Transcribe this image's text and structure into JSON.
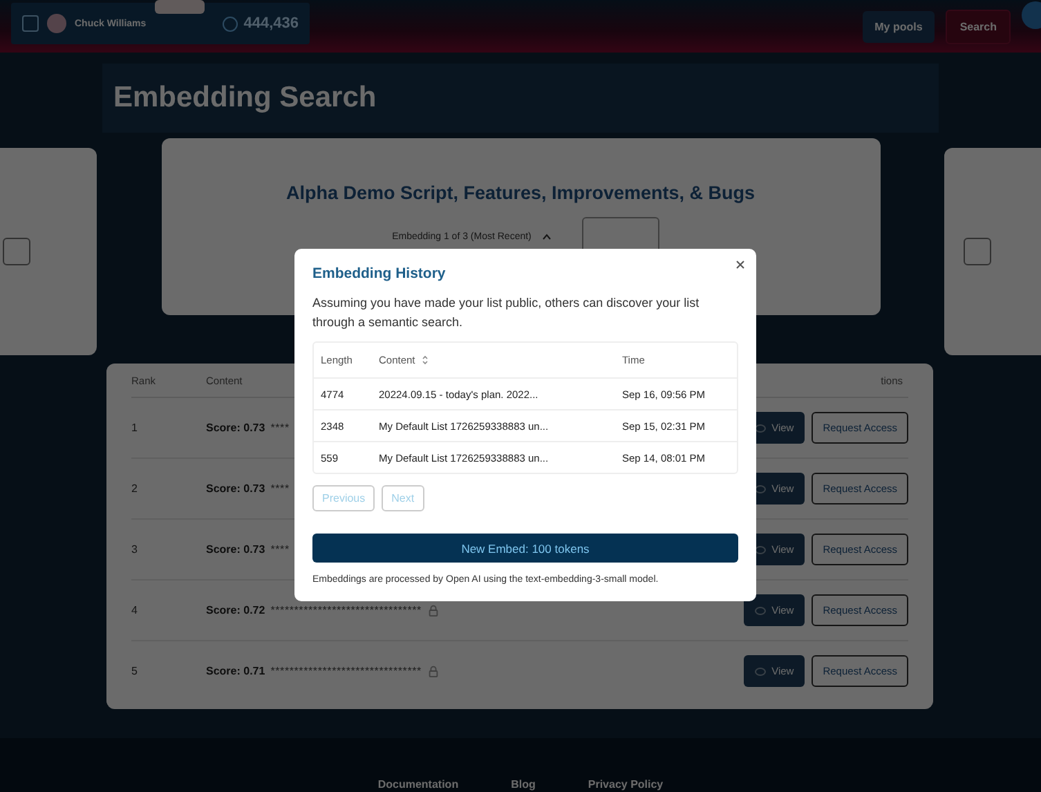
{
  "header": {
    "user_name": "Chuck Williams",
    "points": "444,436",
    "nav": [
      {
        "label": "My pools",
        "selected": false
      },
      {
        "label": "Search",
        "selected": true
      }
    ]
  },
  "page_title": "Embedding Search",
  "side_cards": [
    {
      "checked": false
    },
    {
      "checked": false
    }
  ],
  "list_card": {
    "title": "Alpha Demo Script, Features, Improvements, & Bugs",
    "select_value": "Embedding 1 of 3 (Most Recent)"
  },
  "results": {
    "columns": [
      "Rank",
      "Content",
      "tions"
    ],
    "rows": [
      {
        "rank": "1",
        "score": "Score: 0.73",
        "content": "****",
        "locked": false,
        "actions": [
          "View",
          "Request Access"
        ]
      },
      {
        "rank": "2",
        "score": "Score: 0.73",
        "content": "****",
        "locked": false,
        "actions": [
          "View",
          "Request Access"
        ]
      },
      {
        "rank": "3",
        "score": "Score: 0.73",
        "content": "****",
        "locked": false,
        "actions": [
          "View",
          "Request Access"
        ]
      },
      {
        "rank": "4",
        "score": "Score: 0.72",
        "content": "********************************",
        "locked": true,
        "actions": [
          "View",
          "Request Access"
        ]
      },
      {
        "rank": "5",
        "score": "Score: 0.71",
        "content": "********************************",
        "locked": true,
        "actions": [
          "View",
          "Request Access"
        ]
      }
    ]
  },
  "modal": {
    "title": "Embedding History",
    "description": "Assuming you have made your list public, others can discover your list through a semantic search.",
    "table": {
      "columns": [
        {
          "label": "Length",
          "sortable": false
        },
        {
          "label": "Content",
          "sortable": true
        },
        {
          "label": "Time",
          "sortable": false
        }
      ],
      "rows": [
        [
          "4774",
          "20224.09.15 - today's plan. 2022...",
          "Sep 16, 09:56 PM"
        ],
        [
          "2348",
          "My Default List 1726259338883 un...",
          "Sep 15, 02:31 PM"
        ],
        [
          "559",
          "My Default List 1726259338883 un...",
          "Sep 14, 08:01 PM"
        ]
      ]
    },
    "pagination": [
      {
        "label": "Previous",
        "disabled": true
      },
      {
        "label": "Next",
        "disabled": true
      }
    ],
    "embed_button": "New Embed: 100 tokens",
    "footnote": "Embeddings are processed by Open AI using the text-embedding-3-small model."
  },
  "footer": {
    "links": [
      "Documentation",
      "Blog",
      "Privacy Policy"
    ]
  }
}
